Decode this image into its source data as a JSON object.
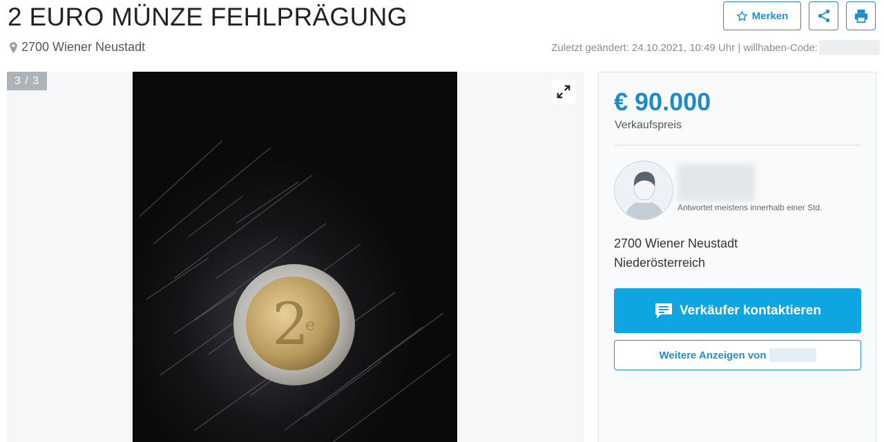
{
  "listing": {
    "title": "2 EURO MÜNZE FEHLPRÄGUNG",
    "location": "2700 Wiener Neustadt",
    "meta": "Zuletzt geändert: 24.10.2021, 10:49 Uhr | willhaben-Code:"
  },
  "actions": {
    "merken_label": "Merken"
  },
  "gallery": {
    "counter": "3 / 3"
  },
  "panel": {
    "price": "€ 90.000",
    "price_label": "Verkaufspreis",
    "response_time": "Antwortet meistens innerhalb einer Std.",
    "address_line1": "2700 Wiener Neustadt",
    "address_line2": "Niederösterreich",
    "contact_label": "Verkäufer kontaktieren",
    "more_label": "Weitere Anzeigen von"
  },
  "colors": {
    "accent": "#1f8fc9",
    "price": "#1b8cc8",
    "contact_button": "#0ea5e0"
  },
  "icons": [
    "map-pin-icon",
    "star-icon",
    "share-icon",
    "print-icon",
    "expand-icon",
    "chat-icon",
    "user-avatar-icon"
  ]
}
